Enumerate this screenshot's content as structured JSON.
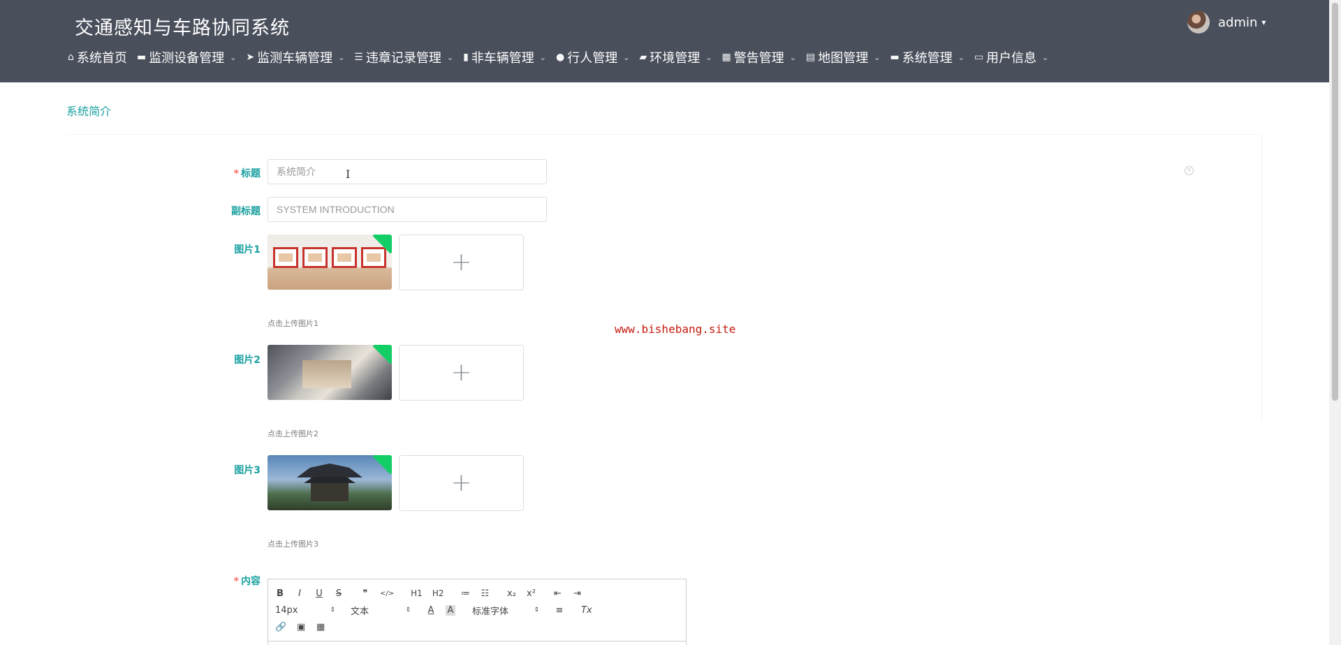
{
  "header": {
    "title": "交通感知与车路协同系统",
    "user": {
      "name": "admin",
      "caret": "▾"
    }
  },
  "nav": [
    {
      "icon": "⌂",
      "label": "系统首页",
      "chevron": ""
    },
    {
      "icon": "▬",
      "label": "监测设备管理",
      "chevron": "⌄"
    },
    {
      "icon": "➤",
      "label": "监测车辆管理",
      "chevron": "⌄"
    },
    {
      "icon": "☰",
      "label": "违章记录管理",
      "chevron": "⌄"
    },
    {
      "icon": "▮",
      "label": "非车辆管理",
      "chevron": "⌄"
    },
    {
      "icon": "●",
      "label": "行人管理",
      "chevron": "⌄"
    },
    {
      "icon": "▰",
      "label": "环境管理",
      "chevron": "⌄"
    },
    {
      "icon": "▦",
      "label": "警告管理",
      "chevron": "⌄"
    },
    {
      "icon": "▤",
      "label": "地图管理",
      "chevron": "⌄"
    },
    {
      "icon": "▬",
      "label": "系统管理",
      "chevron": "⌄"
    },
    {
      "icon": "▭",
      "label": "用户信息",
      "chevron": "⌄"
    }
  ],
  "breadcrumb": "系统简介",
  "form": {
    "title_label": "标题",
    "title_required": "*",
    "title_value": "系统简介",
    "subtitle_label": "副标题",
    "subtitle_value": "SYSTEM INTRODUCTION",
    "images": [
      {
        "label": "图片1",
        "hint": "点击上传图片1"
      },
      {
        "label": "图片2",
        "hint": "点击上传图片2"
      },
      {
        "label": "图片3",
        "hint": "点击上传图片3"
      }
    ],
    "upload_plus": "+",
    "content_label": "内容",
    "content_required": "*"
  },
  "editor": {
    "row1": [
      "B",
      "I",
      "U",
      "S",
      "❞",
      "</>",
      "H1",
      "H2",
      "≔",
      "☷",
      "x₂",
      "x²",
      "⇤",
      "⇥"
    ],
    "font_size": "14px",
    "header_select": "文本",
    "color": "A",
    "background": "A",
    "font_family": "标准字体",
    "align": "≡",
    "clean": "Tx",
    "row3": [
      "🔗",
      "▣",
      "▦"
    ]
  },
  "close_icon": "×",
  "watermark": "www.bishebang.site",
  "text_cursor": "I"
}
